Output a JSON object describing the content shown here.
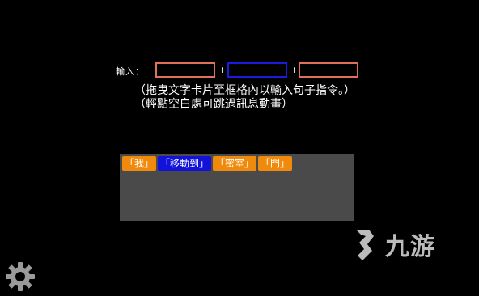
{
  "input_row": {
    "label": "輸入：",
    "plus_1": "+",
    "plus_2": "+"
  },
  "instructions": "（拖曳文字卡片至框格內以輸入句子指令。）（輕點空白處可跳過訊息動畫）",
  "cards": [
    {
      "text": "「我」",
      "color": "#f08a0c"
    },
    {
      "text": "「移動到」",
      "color": "#1212d8"
    },
    {
      "text": "「密室」",
      "color": "#f08a0c"
    },
    {
      "text": "「門」",
      "color": "#f08a0c"
    }
  ],
  "watermark": {
    "text": "九游"
  },
  "colors": {
    "background": "#000000",
    "slot_orange": "#e0705a",
    "slot_blue": "#1a1ae0",
    "panel": "#4a4a4a"
  },
  "icons": {
    "settings": "gear-icon",
    "watermark_logo": "nine-game-logo"
  }
}
